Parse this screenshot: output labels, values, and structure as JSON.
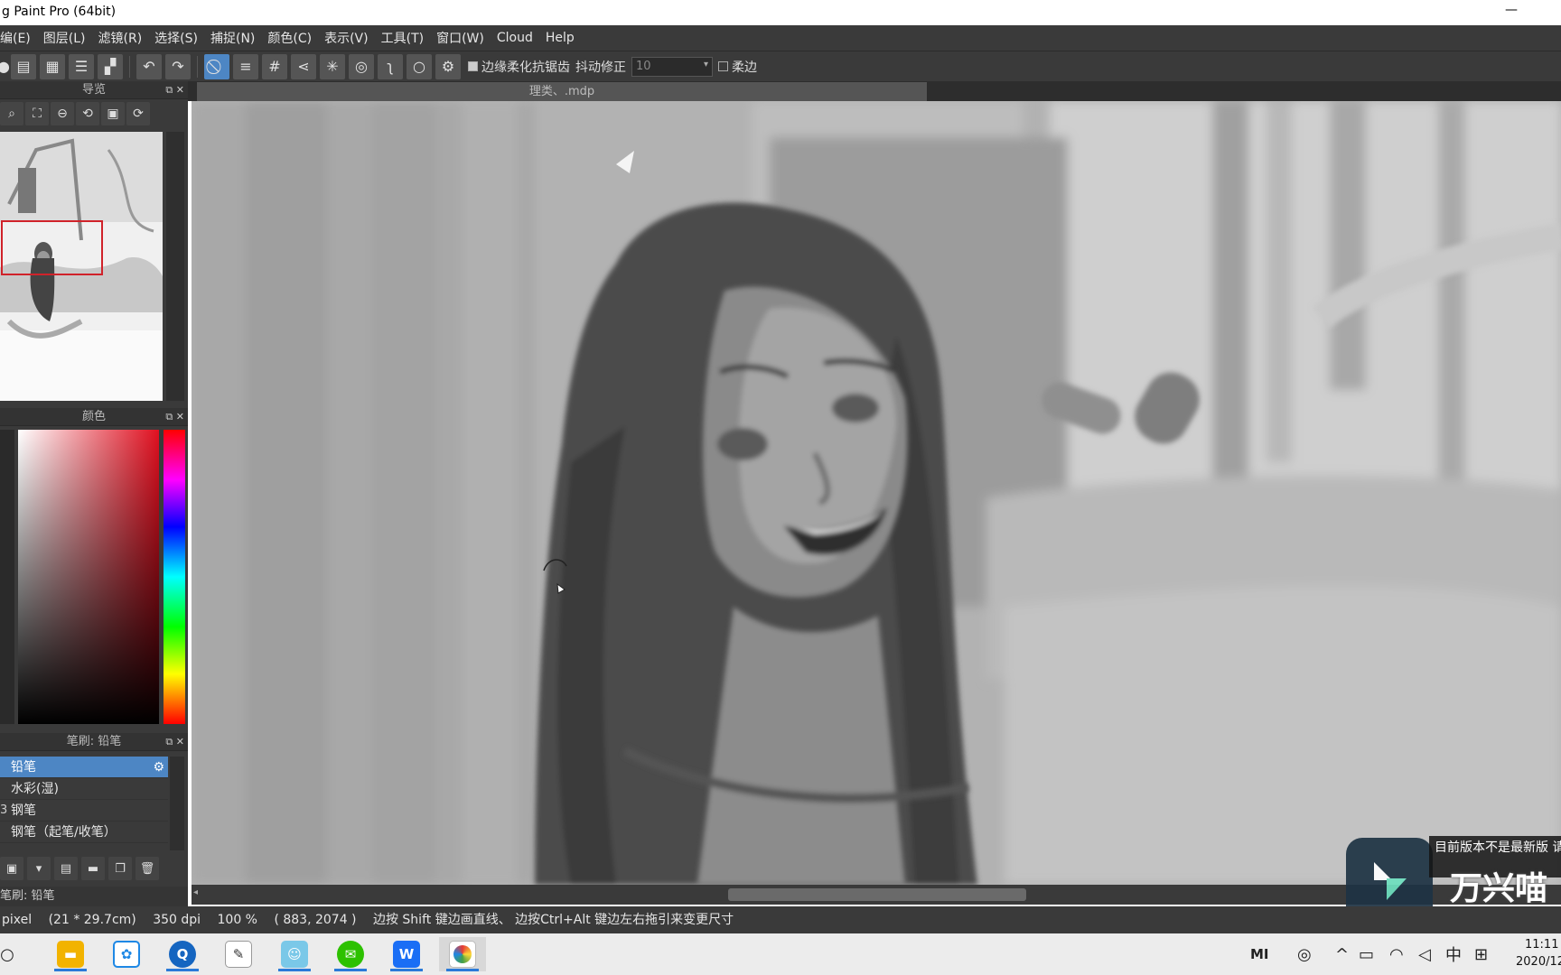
{
  "window": {
    "title": "g Paint Pro (64bit)",
    "minimize": "—"
  },
  "menu": [
    "编(E)",
    "图层(L)",
    "滤镜(R)",
    "选择(S)",
    "捕捉(N)",
    "颜色(C)",
    "表示(V)",
    "工具(T)",
    "窗口(W)",
    "Cloud",
    "Help"
  ],
  "toolbar": {
    "antialias_label": "边缘柔化抗锯齿",
    "stabilizer_label": "抖动修正",
    "stabilizer_value": "10",
    "soft_edge_label": "柔边"
  },
  "panels": {
    "navigator_title": "导览",
    "color_title": "颜色",
    "brush_title": "笔刷: 铅笔",
    "brushes": [
      {
        "name": "铅笔",
        "selected": true,
        "index": ""
      },
      {
        "name": "水彩(湿)",
        "selected": false,
        "index": ""
      },
      {
        "name": "钢笔",
        "selected": false,
        "index": "3"
      },
      {
        "name": "钢笔（起笔/收笔）",
        "selected": false,
        "index": ""
      }
    ],
    "brush_footer": "笔刷: 铅笔"
  },
  "document": {
    "tab_title": "理类、.mdp"
  },
  "status": {
    "pixel": "pixel",
    "size": "(21 * 29.7cm)",
    "dpi": "350 dpi",
    "zoom": "100 %",
    "coords": "( 883, 2074 )",
    "hint": "边按 Shift 键边画直线、 边按Ctrl+Alt 键边左右拖引来变更尺寸"
  },
  "watermark": {
    "brand": "万兴喵",
    "notice": "目前版本不是最新版 请在此下载最新"
  },
  "taskbar": {
    "clock_time": "11:11",
    "clock_date": "2020/12",
    "ime": "中",
    "tray_mi": "MI"
  },
  "colors": {
    "panel_bg": "#3a3a3a",
    "accent": "#4d86c4",
    "canvas_bg": "#b0b0b0"
  }
}
